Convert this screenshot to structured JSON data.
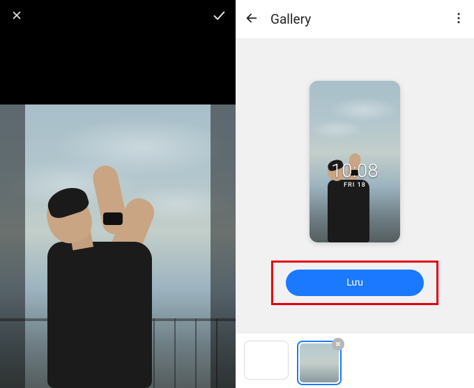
{
  "left": {
    "cancel_icon": "close",
    "confirm_icon": "check"
  },
  "right": {
    "back_icon": "arrow-left",
    "title": "Gallery",
    "more_icon": "more-vertical",
    "clock": {
      "time": "10:08",
      "date": "FRI 18"
    },
    "save_button_label": "Lưu",
    "thumbnails": {
      "remove_icon": "close"
    }
  }
}
